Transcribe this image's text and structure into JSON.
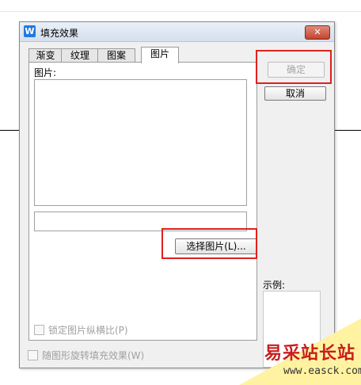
{
  "dialog": {
    "title": "填充效果",
    "app_icon": "W",
    "close_glyph": "✕",
    "tabs": [
      {
        "label": "渐变"
      },
      {
        "label": "纹理"
      },
      {
        "label": "图案"
      },
      {
        "label": "图片"
      }
    ],
    "picture_label": "图片:",
    "select_picture_button": "选择图片(L)...",
    "lock_aspect_label": "锁定图片纵横比(P)",
    "rotate_with_shape_label": "随图形旋转填充效果(W)",
    "ok_button": "确定",
    "cancel_button": "取消",
    "example_label": "示例:"
  },
  "watermark": {
    "text": "易采站长站",
    "url": "www.easck.com"
  },
  "colors": {
    "highlight": "#e0201c",
    "title_gradient_top": "#eaf0f8",
    "close_button": "#c4442f",
    "app_icon": "#1f7ae0"
  }
}
